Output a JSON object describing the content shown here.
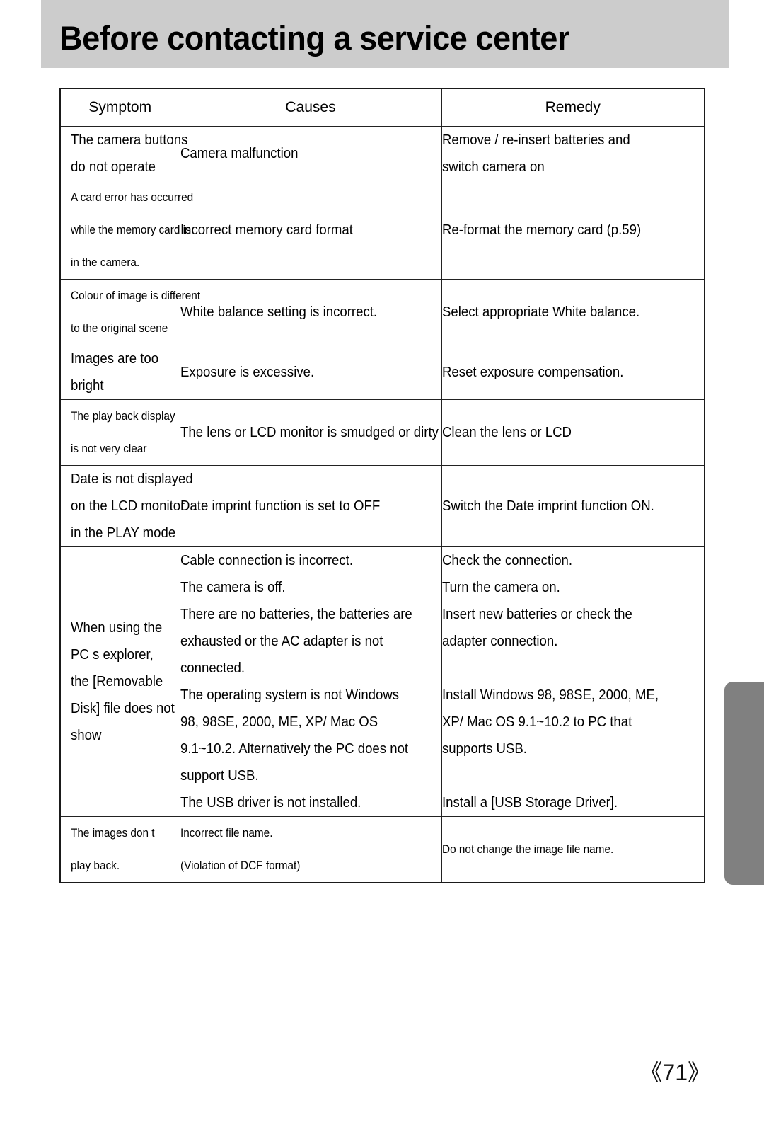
{
  "page": {
    "title": "Before contacting a service center",
    "page_number": "《71》",
    "banner_color": "#cccccc",
    "tab_marker_color": "#808080"
  },
  "table": {
    "headers": [
      "Symptom",
      "Causes",
      "Remedy"
    ],
    "rows": [
      {
        "symptom": [
          "The camera buttons",
          "do not operate"
        ],
        "symptom_size": "normal",
        "causes": [
          "Camera malfunction"
        ],
        "remedy": [
          "Remove / re-insert batteries and",
          "switch camera on"
        ]
      },
      {
        "symptom": [
          "A card error has occurred",
          "while the memory card is",
          "in the camera."
        ],
        "symptom_size": "small",
        "causes": [
          "Incorrect memory card format"
        ],
        "remedy": [
          "Re-format the memory card (p.59)"
        ]
      },
      {
        "symptom": [
          "Colour of image is different",
          "to the original scene"
        ],
        "symptom_size": "small",
        "causes": [
          "White balance setting is incorrect."
        ],
        "remedy": [
          "Select appropriate White balance."
        ]
      },
      {
        "symptom": [
          "Images are too",
          "bright"
        ],
        "symptom_size": "normal",
        "causes": [
          "Exposure is excessive."
        ],
        "remedy": [
          "Reset exposure compensation."
        ]
      },
      {
        "symptom": [
          "The play back display",
          "is not very clear"
        ],
        "symptom_size": "small",
        "causes": [
          "The lens or LCD monitor is smudged or dirty"
        ],
        "remedy": [
          "Clean the lens or LCD"
        ]
      },
      {
        "symptom": [
          "Date is not displayed",
          "on the LCD monitor",
          "in the PLAY mode"
        ],
        "symptom_size": "normal",
        "causes": [
          "Date imprint function is set to OFF"
        ],
        "remedy": [
          "Switch the Date imprint function ON."
        ]
      },
      {
        "symptom": [
          "When using the",
          "PC s explorer,",
          "the [Removable",
          "Disk] file does not",
          "show"
        ],
        "symptom_size": "normal",
        "causes": [
          "Cable connection is incorrect.",
          "The camera is off.",
          "There are no batteries, the batteries are",
          "exhausted or the AC adapter is not",
          "connected.",
          "The operating system is not Windows",
          "98, 98SE, 2000, ME, XP/ Mac OS",
          "9.1~10.2. Alternatively the PC does not",
          "support USB.",
          "The USB driver is not installed."
        ],
        "remedy": [
          "Check the connection.",
          "Turn the camera on.",
          "Insert new batteries or check the",
          "adapter connection.",
          "",
          "Install Windows 98, 98SE, 2000, ME,",
          "XP/ Mac OS 9.1~10.2 to PC that",
          "supports USB.",
          "",
          "Install a [USB Storage Driver]."
        ]
      },
      {
        "symptom": [
          "The images don t",
          "play back."
        ],
        "symptom_size": "small",
        "causes": [
          "Incorrect file name.",
          "(Violation of DCF format)"
        ],
        "remedy": [
          "Do not change the image file name."
        ]
      }
    ]
  }
}
